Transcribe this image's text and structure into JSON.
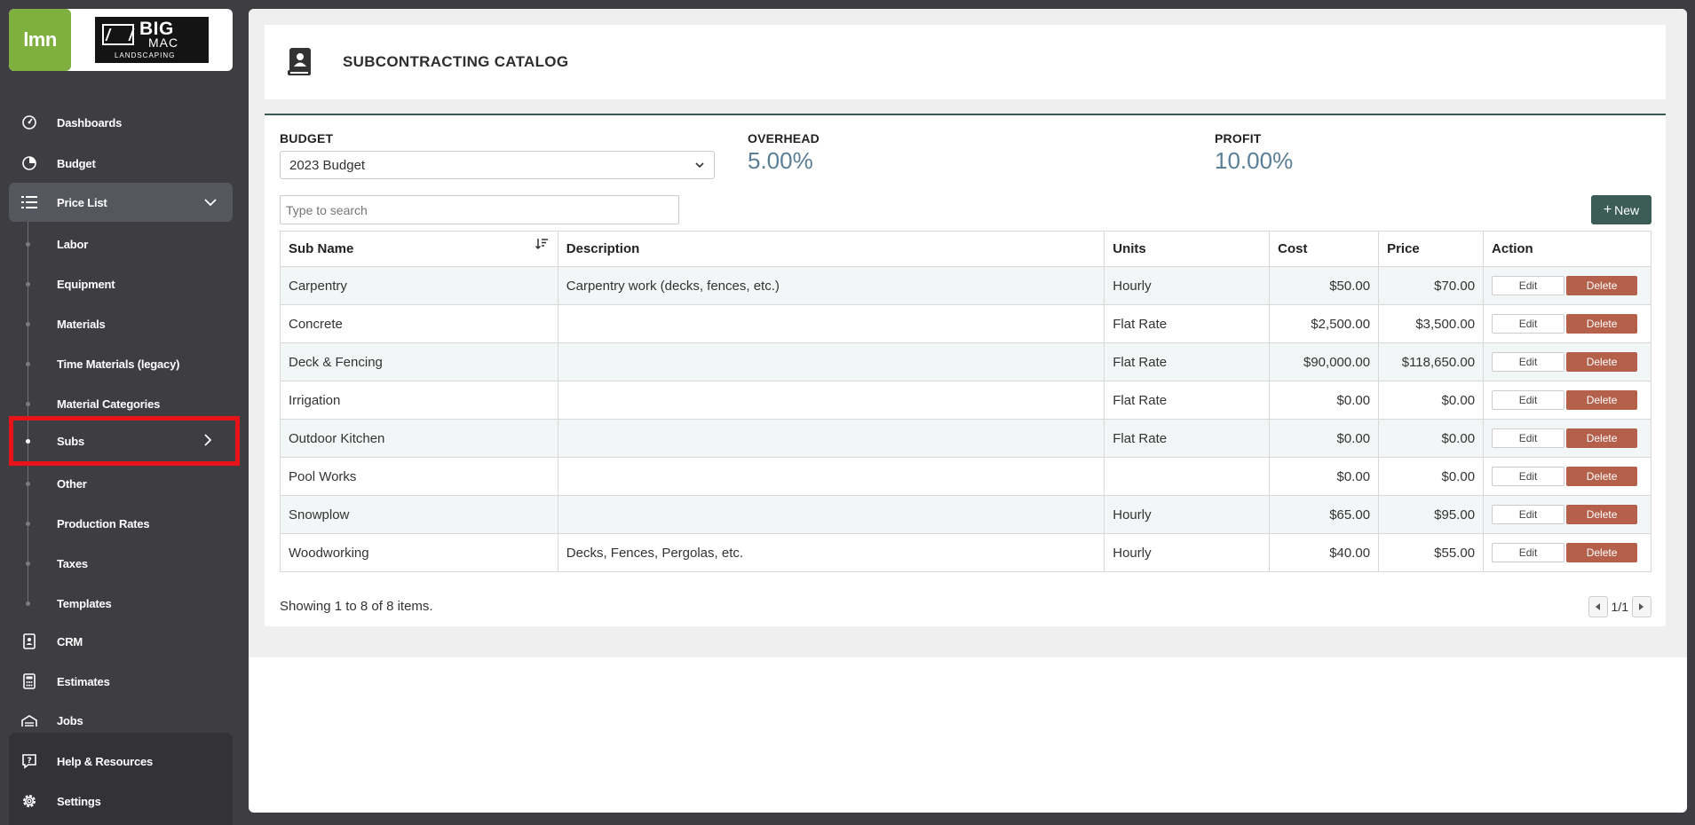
{
  "sidebar": {
    "logo_text": "lmn",
    "company_logo": {
      "line1": "BIG",
      "line2": "MAC",
      "line3": "LANDSCAPING"
    },
    "nav": [
      {
        "label": "Dashboards",
        "icon": "gauge-icon"
      },
      {
        "label": "Budget",
        "icon": "pie-chart-icon"
      },
      {
        "label": "Price List",
        "icon": "list-icon"
      }
    ],
    "price_list_items": [
      {
        "label": "Labor"
      },
      {
        "label": "Equipment"
      },
      {
        "label": "Materials"
      },
      {
        "label": "Time Materials (legacy)"
      },
      {
        "label": "Material Categories"
      },
      {
        "label": "Subs"
      },
      {
        "label": "Other"
      },
      {
        "label": "Production Rates"
      },
      {
        "label": "Taxes"
      },
      {
        "label": "Templates"
      }
    ],
    "nav_after": [
      {
        "label": "CRM",
        "icon": "contact-card-icon"
      },
      {
        "label": "Estimates",
        "icon": "calculator-icon"
      },
      {
        "label": "Jobs",
        "icon": "garage-icon"
      }
    ],
    "bottom": [
      {
        "label": "Help & Resources",
        "icon": "help-icon"
      },
      {
        "label": "Settings",
        "icon": "gear-icon"
      }
    ]
  },
  "page": {
    "title": "SUBCONTRACTING CATALOG"
  },
  "budget": {
    "label": "BUDGET",
    "selected": "2023 Budget"
  },
  "overhead": {
    "label": "OVERHEAD",
    "value": "5.00%"
  },
  "profit": {
    "label": "PROFIT",
    "value": "10.00%"
  },
  "search": {
    "placeholder": "Type to search"
  },
  "new_button": "New",
  "table": {
    "headers": [
      "Sub Name",
      "Description",
      "Units",
      "Cost",
      "Price",
      "Action"
    ],
    "rows": [
      {
        "name": "Carpentry",
        "description": "Carpentry work (decks, fences, etc.)",
        "units": "Hourly",
        "cost": "$50.00",
        "price": "$70.00"
      },
      {
        "name": "Concrete",
        "description": "",
        "units": "Flat Rate",
        "cost": "$2,500.00",
        "price": "$3,500.00"
      },
      {
        "name": "Deck & Fencing",
        "description": "",
        "units": "Flat Rate",
        "cost": "$90,000.00",
        "price": "$118,650.00"
      },
      {
        "name": "Irrigation",
        "description": "",
        "units": "Flat Rate",
        "cost": "$0.00",
        "price": "$0.00"
      },
      {
        "name": "Outdoor Kitchen",
        "description": "",
        "units": "Flat Rate",
        "cost": "$0.00",
        "price": "$0.00"
      },
      {
        "name": "Pool Works",
        "description": "",
        "units": "",
        "cost": "$0.00",
        "price": "$0.00"
      },
      {
        "name": "Snowplow",
        "description": "",
        "units": "Hourly",
        "cost": "$65.00",
        "price": "$95.00"
      },
      {
        "name": "Woodworking",
        "description": "Decks, Fences, Pergolas, etc.",
        "units": "Hourly",
        "cost": "$40.00",
        "price": "$55.00"
      }
    ],
    "edit_label": "Edit",
    "delete_label": "Delete"
  },
  "footer": {
    "showing": "Showing 1 to 8 of 8 items.",
    "page": "1/1"
  },
  "colors": {
    "sidebar_bg": "#3d3d42",
    "brand_green": "#7fb03f",
    "new_button": "#3b5d55",
    "delete_button": "#b5604a",
    "highlight": "#e8121a",
    "value_blue": "#5a7f96"
  }
}
